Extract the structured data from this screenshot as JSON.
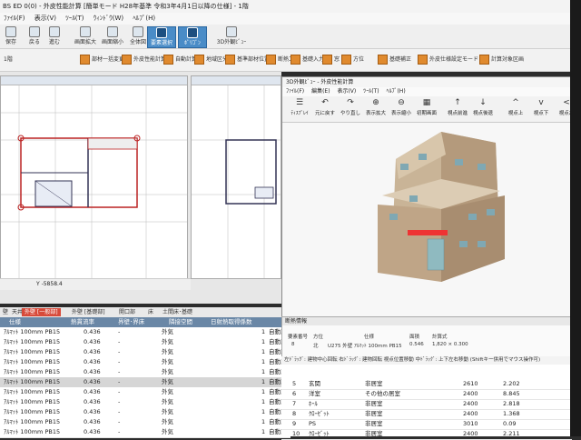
{
  "window": {
    "title": "BS ED 0(0) - 外皮性能計算 [簡単モード H28年基準 令和3年4月1日以降の仕様] - 1階",
    "menus": [
      "ﾌｧｲﾙ(F)",
      "表示(V)",
      "ﾂｰﾙ(T)",
      "ｳｨﾝﾄﾞｳ(W)",
      "ﾍﾙﾌﾟ(H)"
    ]
  },
  "toolbar1": {
    "items": [
      "保存",
      "戻る",
      "進む",
      "画面拡大",
      "画面縮小",
      "全体図",
      "要素選択",
      "ﾎﾟﾘｺﾞﾝ",
      "3D外観ﾋﾞｭｰ"
    ]
  },
  "toolbar2": {
    "floor": "1階",
    "items": [
      "部材一括変更",
      "外皮性能計算",
      "自動計算",
      "地域区分",
      "基準部材位置",
      "断熱工事",
      "基礎入力",
      "窓",
      "方位",
      "基礎補正",
      "外皮仕様設定モード",
      "計算対象区画"
    ]
  },
  "statusbar": {
    "coord": "Y -5858.4"
  },
  "tabs": [
    "壁",
    "天井",
    "外壁 [一般部]",
    "外壁 [基礎部]",
    "開口部",
    "床",
    "土間床･基礎"
  ],
  "table": {
    "headers": [
      "仕様",
      "熱貫流率",
      "界壁･界床",
      "隣接空間",
      "日射熱取得係数"
    ],
    "rows": [
      {
        "spec": "ｱﾙﾏｯﾄ 100mm PB15",
        "u": "0.436",
        "party": "-",
        "adj": "外気",
        "n": "1",
        "calc": "自動計算"
      },
      {
        "spec": "ｱﾙﾏｯﾄ 100mm PB15",
        "u": "0.436",
        "party": "-",
        "adj": "外気",
        "n": "1",
        "calc": "自動計算"
      },
      {
        "spec": "ｱﾙﾏｯﾄ 100mm PB15",
        "u": "0.436",
        "party": "-",
        "adj": "外気",
        "n": "1",
        "calc": "自動計算"
      },
      {
        "spec": "ｱﾙﾏｯﾄ 100mm PB15",
        "u": "0.436",
        "party": "-",
        "adj": "外気",
        "n": "1",
        "calc": "自動計算"
      },
      {
        "spec": "ｱﾙﾏｯﾄ 100mm PB15",
        "u": "0.436",
        "party": "-",
        "adj": "外気",
        "n": "1",
        "calc": "自動計算"
      },
      {
        "spec": "ｱﾙﾏｯﾄ 100mm PB15",
        "u": "0.436",
        "party": "-",
        "adj": "外気",
        "n": "1",
        "calc": "自動計算"
      },
      {
        "spec": "ｱﾙﾏｯﾄ 100mm PB15",
        "u": "0.436",
        "party": "-",
        "adj": "外気",
        "n": "1",
        "calc": "自動計算"
      },
      {
        "spec": "ｱﾙﾏｯﾄ 100mm PB15",
        "u": "0.436",
        "party": "-",
        "adj": "外気",
        "n": "1",
        "calc": "自動計算"
      },
      {
        "spec": "ｱﾙﾏｯﾄ 100mm PB15",
        "u": "0.436",
        "party": "-",
        "adj": "外気",
        "n": "1",
        "calc": "自動計算"
      },
      {
        "spec": "ｱﾙﾏｯﾄ 100mm PB15",
        "u": "0.436",
        "party": "-",
        "adj": "外気",
        "n": "1",
        "calc": "自動計算"
      },
      {
        "spec": "ｱﾙﾏｯﾄ 100mm PB15",
        "u": "0.436",
        "party": "-",
        "adj": "外気",
        "n": "1",
        "calc": "自動計算"
      }
    ]
  },
  "viewer": {
    "title": "3D外観ﾋﾞｭｰ - 外皮性能計算",
    "menus": [
      "ﾌｧｲﾙ(F)",
      "編集(E)",
      "表示(V)",
      "ﾂｰﾙ(T)",
      "ﾍﾙﾌﾟ(H)"
    ],
    "tools": [
      {
        "icon": "☰",
        "label": "ﾃｨｽﾌﾟﾚｲ"
      },
      {
        "icon": "↶",
        "label": "元に戻す"
      },
      {
        "icon": "↷",
        "label": "やり直し"
      },
      {
        "icon": "⊕",
        "label": "表示拡大"
      },
      {
        "icon": "⊖",
        "label": "表示縮小"
      },
      {
        "icon": "▦",
        "label": "初期画面"
      },
      {
        "icon": "↑",
        "label": "視点前進"
      },
      {
        "icon": "↓",
        "label": "視点後退"
      },
      {
        "icon": "^",
        "label": "視点上"
      },
      {
        "icon": "v",
        "label": "視点下"
      },
      {
        "icon": "<",
        "label": "視点左"
      }
    ]
  },
  "info": {
    "title": "断熱情報",
    "headers": [
      "要素番号",
      "方位",
      "仕様",
      "面積",
      "計算式"
    ],
    "values": [
      "8",
      "北",
      "U275 外壁 ｱﾙﾏｯﾄ 100mm PB15",
      "0.546",
      "1,820 × 0.300"
    ]
  },
  "hint": "左ﾄﾞﾗｯｸﾞ: 建物中心回転  右ﾄﾞﾗｯｸﾞ: 建物回転  視点位置移動  中ﾄﾞﾗｯｸﾞ: 上下左右移動  (Shiftキー併用でマウス操作可)",
  "room_table": {
    "rows": [
      {
        "no": "5",
        "name": "玄関",
        "type": "非居室",
        "h": "2610",
        "area": "2.202"
      },
      {
        "no": "6",
        "name": "洋室",
        "type": "その他の居室",
        "h": "2400",
        "area": "8.845"
      },
      {
        "no": "7",
        "name": "ﾎｰﾙ",
        "type": "非居室",
        "h": "2400",
        "area": "2.818"
      },
      {
        "no": "8",
        "name": "ｸﾛｰｾﾞｯﾄ",
        "type": "非居室",
        "h": "2400",
        "area": "1.368"
      },
      {
        "no": "9",
        "name": "PS",
        "type": "非居室",
        "h": "3010",
        "area": "0.09"
      },
      {
        "no": "10",
        "name": "ｸﾛｰｾﾞｯﾄ",
        "type": "非居室",
        "h": "2400",
        "area": "2.211"
      }
    ]
  },
  "colors": {
    "accent_red": "#d74a3a",
    "header_blue": "#6a87a6",
    "selected_tool": "#4a8cc7",
    "facade": "#b49a7c"
  }
}
